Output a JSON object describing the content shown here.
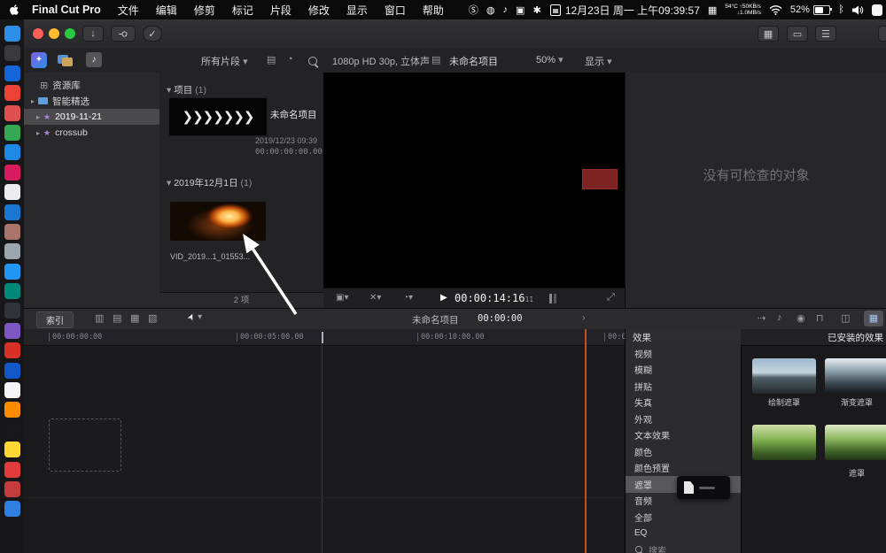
{
  "menubar": {
    "app_name": "Final Cut Pro",
    "menus": [
      "文件",
      "编辑",
      "修剪",
      "标记",
      "片段",
      "修改",
      "显示",
      "窗口",
      "帮助"
    ],
    "datetime": "12月23日 周一 上午09:39:57",
    "stats_line1": "54°C ↑50KB/s",
    "stats_line2": "↓1.0MB/s",
    "battery_pct": "52%"
  },
  "dock": {
    "icon_colors": [
      "#2e8fe8",
      "#3a3a3e",
      "#1565d8",
      "#ea4335",
      "#e05050",
      "#34a853",
      "#1e88e5",
      "#d81b60",
      "#ececf0",
      "#1976d2",
      "#a9746a",
      "#9aa6ad",
      "#2196f3",
      "#00897b",
      "#30343a",
      "#7e57c2",
      "#d93025",
      "#1258c8",
      "#f5f5f7",
      "#fb8c00",
      "#17181a",
      "#fdd835",
      "#e23b3b",
      "#c43c3c",
      "#2f7fe0"
    ]
  },
  "toolbar": {
    "clip_filter": "所有片段",
    "format_info": "1080p HD 30p, 立体声",
    "project_name": "未命名项目",
    "zoom": "50%",
    "view_menu": "显示"
  },
  "sidebar": {
    "items": [
      {
        "label": "资源库"
      },
      {
        "label": "智能精选"
      },
      {
        "label": "2019-11-21"
      },
      {
        "label": "crossub"
      }
    ]
  },
  "browser": {
    "section1_title": "项目",
    "section1_count": "(1)",
    "project_name": "未命名项目",
    "project_date": "2019/12/23 09:39",
    "project_duration": "00:00:00:00.00",
    "section2_title": "2019年12月1日",
    "section2_count": "(1)",
    "clip_name": "VID_2019...1_01553...",
    "status": "2 项"
  },
  "viewer": {
    "timecode": "00:00:14:16",
    "timecode_sub": "11"
  },
  "inspector": {
    "empty_text": "没有可检查的对象"
  },
  "midbar": {
    "index_button": "索引",
    "project_name": "未命名项目",
    "timecode": "00:00:00"
  },
  "timeline": {
    "ruler_labels": [
      "00:00:00:00",
      "00:00:05:00.00",
      "00:00:10:00.00",
      "00:0"
    ]
  },
  "effects": {
    "panel_title": "效果",
    "installed_title": "已安装的效果",
    "categories": [
      "视频",
      "模糊",
      "拼贴",
      "失真",
      "外观",
      "文本效果",
      "颜色",
      "颜色预置",
      "遮罩",
      "音频",
      "全部",
      "EQ"
    ],
    "selected_category": "遮罩",
    "thumbs": [
      {
        "label": "绘制遮罩"
      },
      {
        "label": "渐变遮罩"
      },
      {
        "label": ""
      },
      {
        "label": "遮罩"
      }
    ],
    "search_placeholder": "搜索"
  },
  "icons": {
    "s_badge": "Ⓢ",
    "globe": "◍",
    "note": "♪",
    "display": "▣",
    "swirl": "✱",
    "window_grid": "▦",
    "bluetooth": "ᛒ",
    "chevron_down": "▾",
    "disclosure": "▸",
    "library_grid": "⊞",
    "star": "★",
    "filmstrip_chevrons": "❯❯❯❯❯❯❯",
    "import_arrow": "↓",
    "key": "⚲",
    "check": "✓",
    "ws_grid": "▦",
    "ws_single": "▭",
    "ws_list": "☰",
    "film_icon": "▤",
    "clock_icon": "◔",
    "info_icon": "▤",
    "view_icon": "▣",
    "overlay_icon": "✕",
    "retime_icon": "◔",
    "play": "▶",
    "fullscreen": "⤢",
    "t1": "▥",
    "t2": "▤",
    "t3": "▦",
    "t4": "▧",
    "pointer": "➤",
    "skim": "⇢",
    "audio_skim": "♪",
    "solo": "◉",
    "snap": "⊓",
    "transitions": "◫",
    "effects_grid": "▦",
    "chevron_right": "›"
  }
}
